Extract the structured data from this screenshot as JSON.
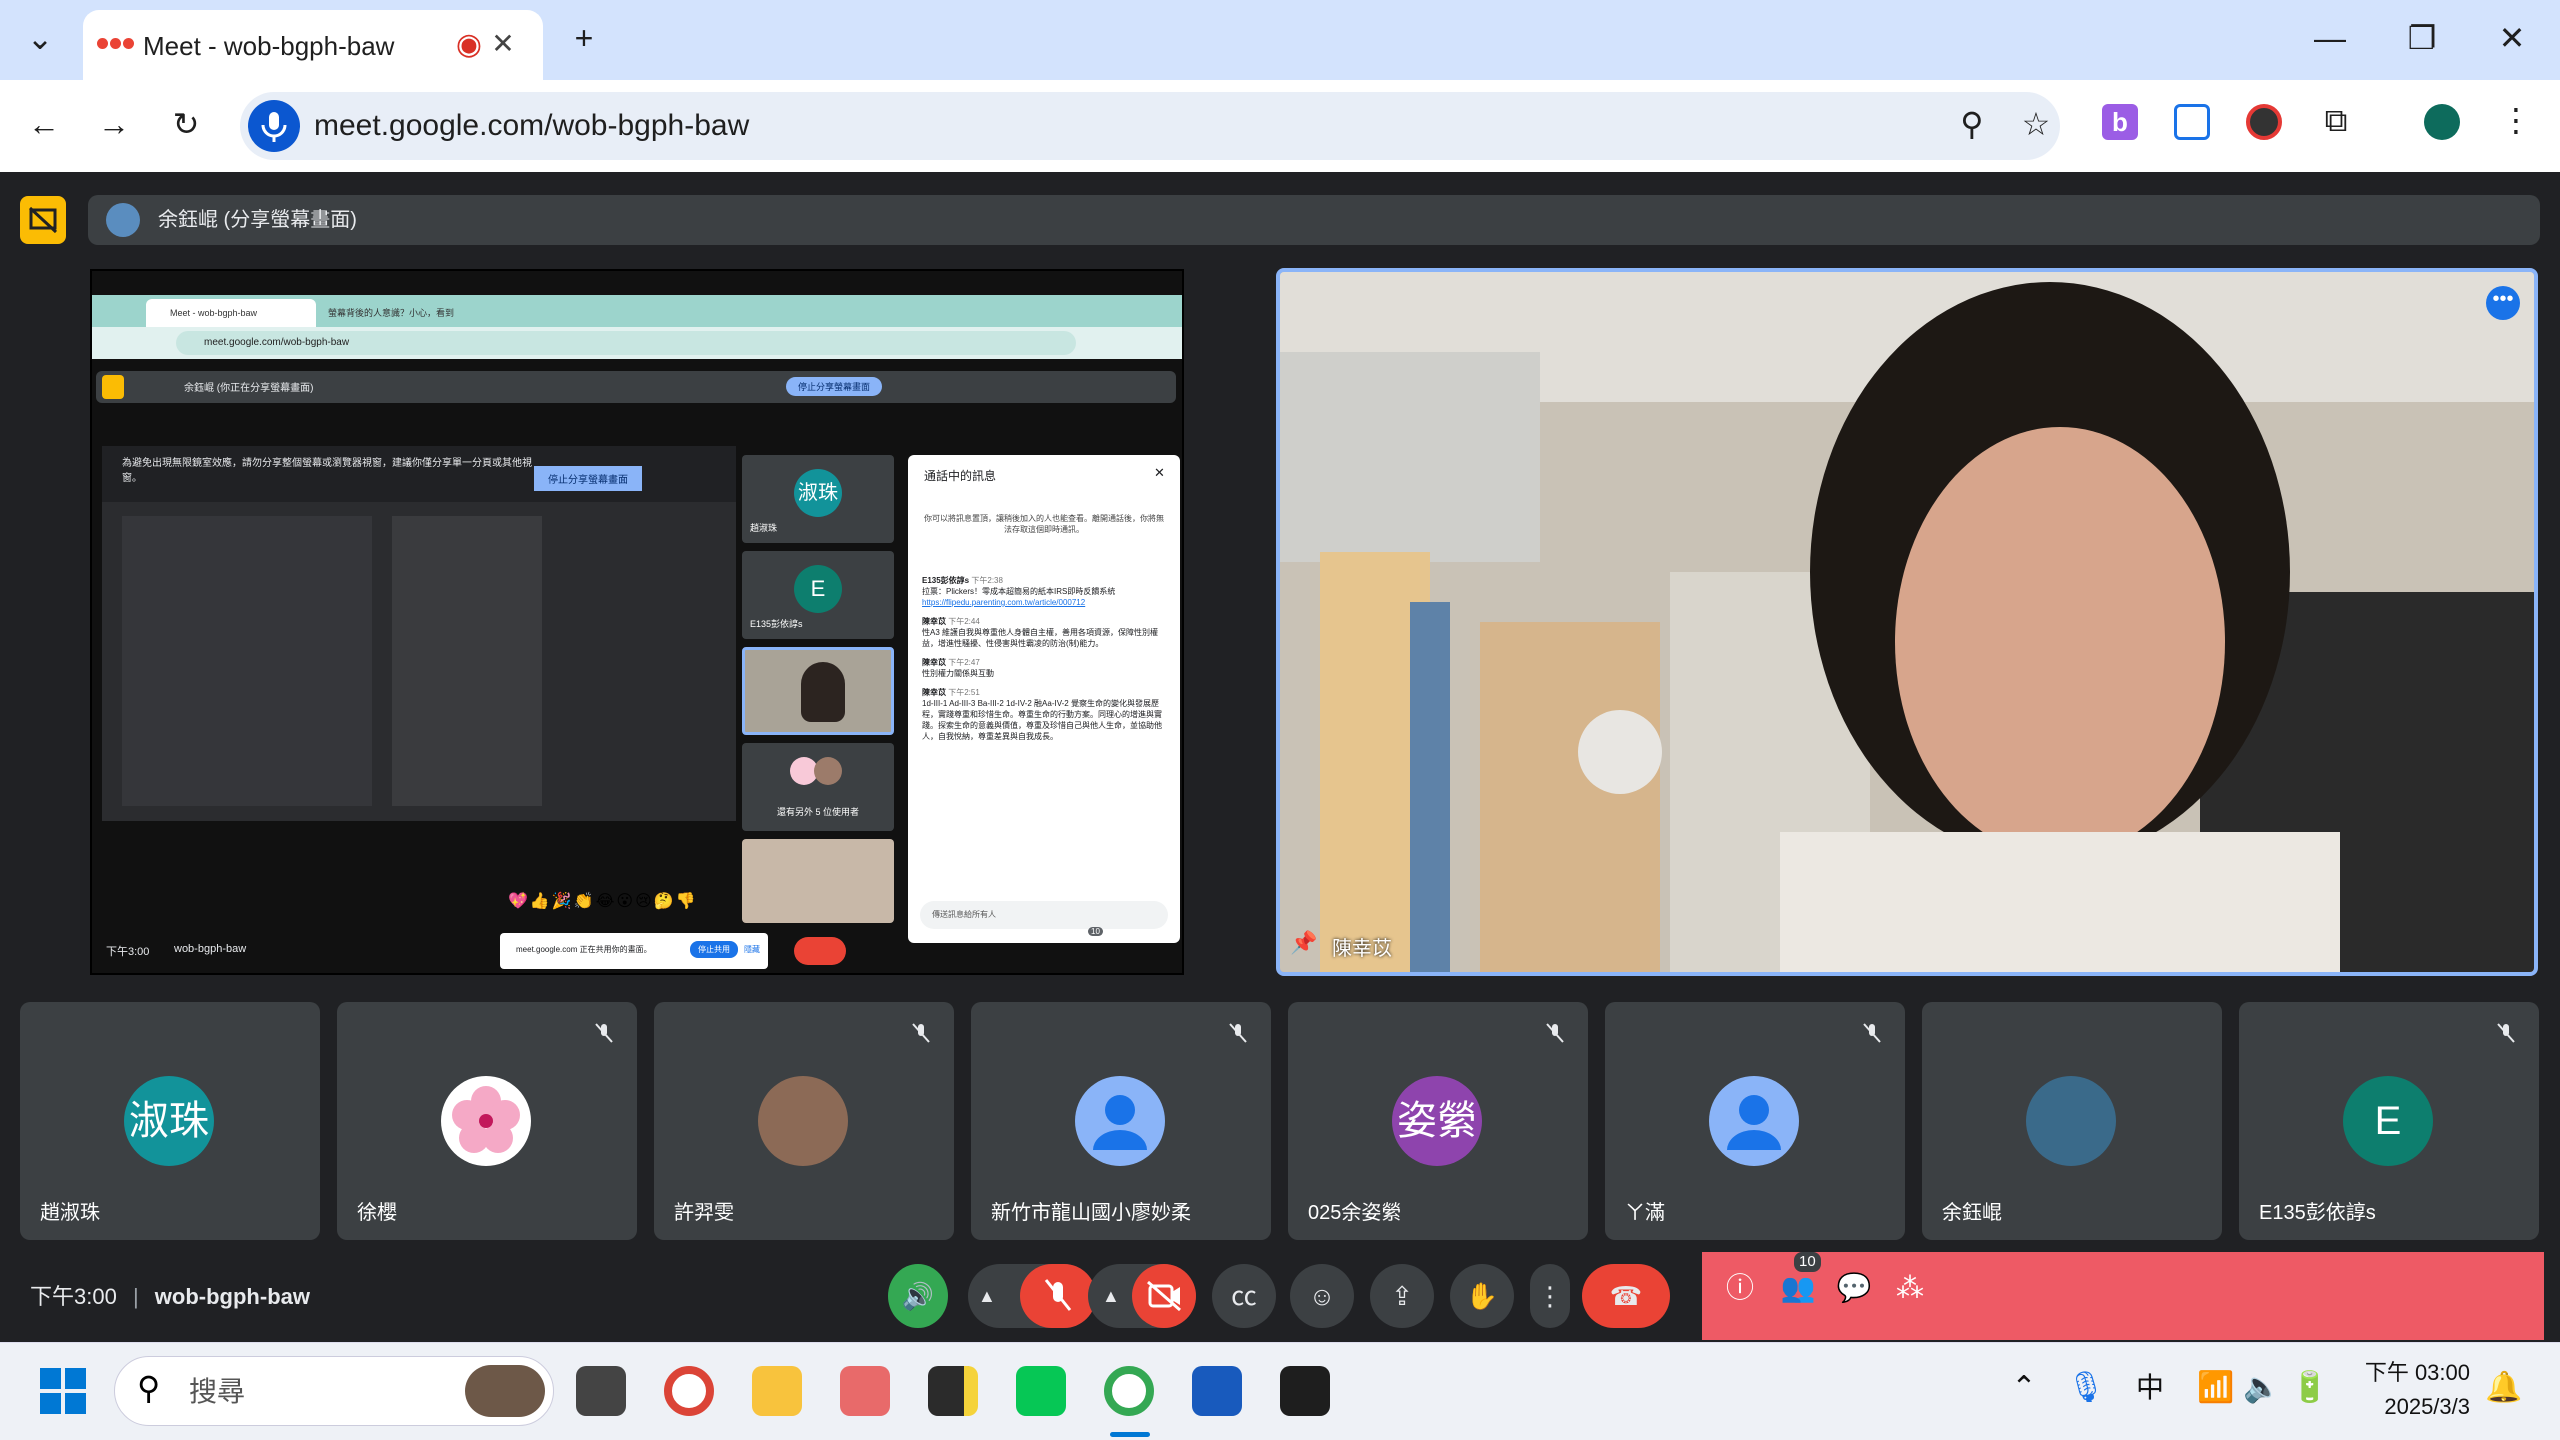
{
  "tab": {
    "title": "Meet - wob-bgph-baw",
    "close": "✕",
    "new": "+"
  },
  "address": {
    "url": "meet.google.com/wob-bgph-baw"
  },
  "presenter_bar": "余鈺崐 (分享螢幕畫面)",
  "shared_screen": {
    "url": "meet.google.com/wob-bgph-baw",
    "inner_tab": "Meet - wob-bgph-baw",
    "inner_tab2": "螢幕背後的人意識？小心，看到",
    "inner_presenter": "余鈺崐 (你正在分享螢幕畫面)",
    "stop_share": "停止分享螢幕畫面",
    "warning": "為避免出現無限鏡室效應，請勿分享整個螢幕或瀏覽器視窗，建議你僅分享單一分頁或其他視窗。",
    "warning_button": "停止分享螢幕畫面",
    "chat_title": "通話中的訊息",
    "chat_note": "你可以將訊息置頂，讓稍後加入的人也能查看。離開通話後，你將無法存取這個即時通訊。",
    "messages": [
      {
        "from": "E135彭依諄s",
        "time": "下午2:38",
        "text": "拉票：Plickers！零成本超簡易的紙本IRS即時反饋系統",
        "link": "https://flipedu.parenting.com.tw/article/000712"
      },
      {
        "from": "陳幸苡",
        "time": "下午2:44",
        "text": "性A3 維護自我與尊重他人身體自主權，善用各項資源，保障性別權益，增進性騷擾、性侵害與性霸凌的防治(制)能力。"
      },
      {
        "from": "陳幸苡",
        "time": "下午2:47",
        "text": "性別權力關係與互動"
      },
      {
        "from": "陳幸苡",
        "time": "下午2:51",
        "text": "1d-III-1 Ad-III-3 Ba-III-2 1d-IV-2 融Aa-IV-2 覺察生命的變化與發展歷程，實踐尊重和珍惜生命。尊重生命的行動方案。同理心的增進與實踐。探索生命的意義與價值，尊重及珍惜自己與他人生命，並協助他人，自我悅納，尊重差異與自我成長。"
      }
    ],
    "chat_input": "傳送訊息給所有人",
    "side_tiles": [
      {
        "initials": "淑珠",
        "name": "趙淑珠"
      },
      {
        "initials": "E",
        "name": "E135彭依諄s"
      },
      {
        "initials": "",
        "name": ""
      },
      {
        "initials": "",
        "name": "還有另外 5 位使用者"
      }
    ],
    "reactions": [
      "💖",
      "👍",
      "🎉",
      "👏",
      "😂",
      "😮",
      "😢",
      "🤔",
      "👎"
    ],
    "bottom_clock": "下午3:00",
    "bottom_code": "wob-bgph-baw",
    "share_notice": "meet.google.com 正在共用你的畫面。",
    "share_stop": "停止共用",
    "share_hide": "隱藏",
    "badge": "10"
  },
  "main_speaker": {
    "name": "陳幸苡"
  },
  "participants": [
    {
      "name": "趙淑珠",
      "initials": "淑珠",
      "color": "#12939a"
    },
    {
      "name": "徐櫻",
      "initials": "",
      "color": "#ffffff"
    },
    {
      "name": "許羿雯",
      "initials": "",
      "color": "#6d5040"
    },
    {
      "name": "新竹市龍山國小廖妙柔",
      "initials": "",
      "color": "#8ab4f8"
    },
    {
      "name": "025余姿縈",
      "initials": "姿縈",
      "color": "#8e44ad"
    },
    {
      "name": "ㄚ滿",
      "initials": "",
      "color": "#8ab4f8"
    },
    {
      "name": "余鈺崐",
      "initials": "",
      "color": "#3a6a8a"
    },
    {
      "name": "E135彭依諄s",
      "initials": "E",
      "color": "#0d7e6e"
    }
  ],
  "meeting": {
    "time": "下午3:00",
    "code": "wob-bgph-baw",
    "people_badge": "10"
  },
  "taskbar": {
    "search": "搜尋",
    "ime": "中",
    "time": "下午 03:00",
    "date": "2025/3/3"
  }
}
